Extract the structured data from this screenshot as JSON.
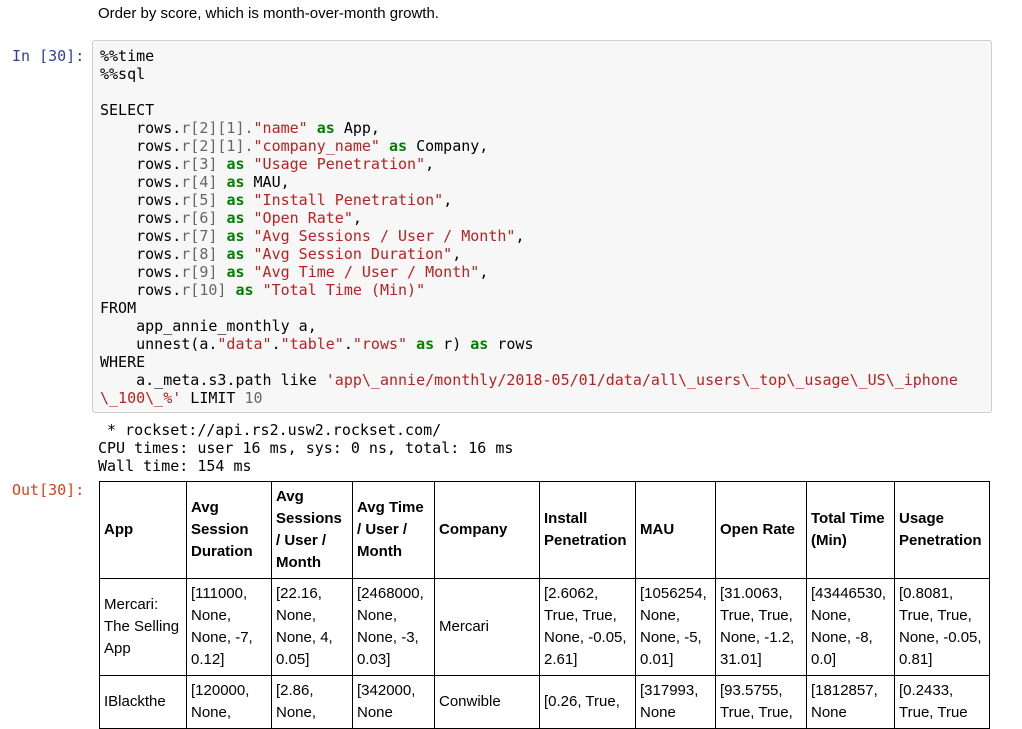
{
  "markdown_text": "Order by score, which is month-over-month growth.",
  "input_prompt": "In [30]:",
  "output_prompt": "Out[30]:",
  "code": {
    "magic1": "%%time",
    "magic2": "%%sql",
    "select": "SELECT",
    "from": "FROM",
    "where": "WHERE",
    "lines": [
      {
        "pre": "    rows",
        "idx": "r[2][1].",
        "str": "\"name\"",
        "as": "as",
        "alias": " App,"
      },
      {
        "pre": "    rows",
        "idx": "r[2][1].",
        "str": "\"company_name\"",
        "as": "as",
        "alias": " Company,"
      },
      {
        "pre": "    rows",
        "idx": "r[3]",
        "as": "as",
        "str": "\"Usage Penetration\"",
        "tail": ","
      },
      {
        "pre": "    rows",
        "idx": "r[4]",
        "as": "as",
        "alias": " MAU,"
      },
      {
        "pre": "    rows",
        "idx": "r[5]",
        "as": "as",
        "str": "\"Install Penetration\"",
        "tail": ","
      },
      {
        "pre": "    rows",
        "idx": "r[6]",
        "as": "as",
        "str": "\"Open Rate\"",
        "tail": ","
      },
      {
        "pre": "    rows",
        "idx": "r[7]",
        "as": "as",
        "str": "\"Avg Sessions / User / Month\"",
        "tail": ","
      },
      {
        "pre": "    rows",
        "idx": "r[8]",
        "as": "as",
        "str": "\"Avg Session Duration\"",
        "tail": ","
      },
      {
        "pre": "    rows",
        "idx": "r[9]",
        "as": "as",
        "str": "\"Avg Time / User / Month\"",
        "tail": ","
      },
      {
        "pre": "    rows",
        "idx": "r[10]",
        "as": "as",
        "str": "\"Total Time (Min)\"",
        "tail": ""
      }
    ],
    "from_line1": "    app_annie_monthly a,",
    "unnest_pre": "    unnest(a.",
    "unnest_s1": "\"data\"",
    "unnest_s2": "\"table\"",
    "unnest_s3": "\"rows\"",
    "unnest_as1": "as",
    "unnest_mid": " r) ",
    "unnest_as2": "as",
    "unnest_tail": " rows",
    "where_pre": "    a._meta.s3.path like ",
    "where_str1": "'app\\_annie/monthly/2018-05/01/data/all\\_users\\_top\\_usage\\_US\\_iphone",
    "where_str2": "\\_100\\_%'",
    "limit_kw": " LIMIT ",
    "limit_num": "10"
  },
  "stdout": [
    " * rockset://api.rs2.usw2.rockset.com/",
    "CPU times: user 16 ms, sys: 0 ns, total: 16 ms",
    "Wall time: 154 ms"
  ],
  "table": {
    "headers": [
      "App",
      "Avg Session Duration",
      "Avg Sessions / User / Month",
      "Avg Time / User / Month",
      "Company",
      "Install Penetration",
      "MAU",
      "Open Rate",
      "Total Time (Min)",
      "Usage Penetration"
    ],
    "rows": [
      [
        "Mercari: The Selling App",
        "[111000, None, None, -7, 0.12]",
        "[22.16, None, None, 4, 0.05]",
        "[2468000, None, None, -3, 0.03]",
        "Mercari",
        "[2.6062, True, True, None, -0.05, 2.61]",
        "[1056254, None, None, -5, 0.01]",
        "[31.0063, True, True, None, -1.2, 31.01]",
        "[43446530, None, None, -8, 0.0]",
        "[0.8081, True, True, None, -0.05, 0.81]"
      ],
      [
        "IBlackthe",
        "[120000, None,",
        "[2.86, None,",
        "[342000, None",
        "Conwible",
        "[0.26, True,",
        "[317993, None",
        "[93.5755, True, True,",
        "[1812857, None",
        "[0.2433, True, True"
      ]
    ]
  }
}
